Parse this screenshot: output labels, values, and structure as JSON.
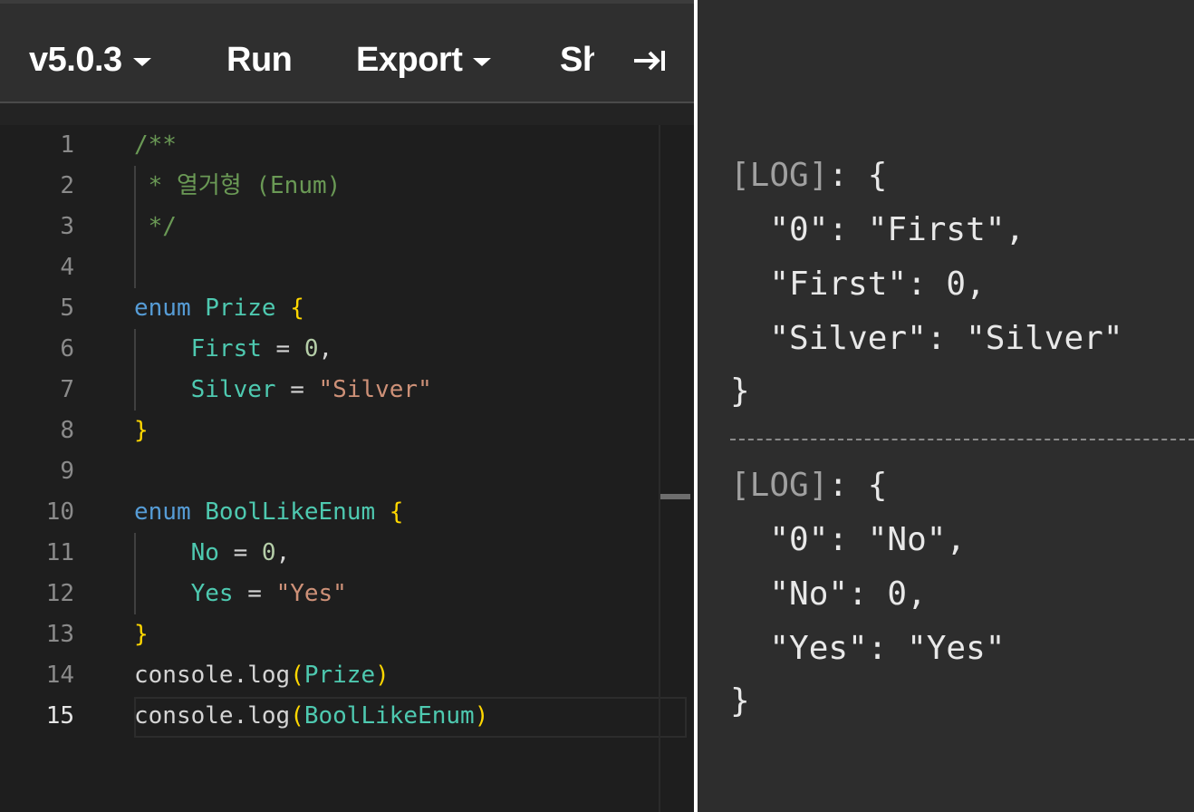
{
  "toolbar": {
    "version_label": "v5.0.3",
    "run_label": "Run",
    "export_label": "Export",
    "share_label": "Share",
    "collapse_icon": "arrow-right-to-bar-icon"
  },
  "editor": {
    "line_numbers": [
      "1",
      "2",
      "3",
      "4",
      "5",
      "6",
      "7",
      "8",
      "9",
      "10",
      "11",
      "12",
      "13",
      "14",
      "15"
    ],
    "active_line": 15,
    "code": {
      "l1": "/**",
      "l2": " * 열거형 (Enum)",
      "l3": " */",
      "l5_kw": "enum",
      "l5_name": "Prize",
      "l6_name": "First",
      "l6_num": "0",
      "l7_name": "Silver",
      "l7_str": "\"Silver\"",
      "l10_kw": "enum",
      "l10_name": "BoolLikeEnum",
      "l11_name": "No",
      "l11_num": "0",
      "l12_name": "Yes",
      "l12_str": "\"Yes\"",
      "l14_obj": "console.log",
      "l14_arg": "Prize",
      "l15_obj": "console.log",
      "l15_arg": "BoolLikeEnum"
    }
  },
  "output": {
    "log_tag": "[LOG]",
    "log1": {
      "line1": "\"0\": \"First\",",
      "line2": "\"First\": 0,",
      "line3": "\"Silver\": \"Silver\""
    },
    "log2": {
      "line1": "\"0\": \"No\",",
      "line2": "\"No\": 0,",
      "line3": "\"Yes\": \"Yes\""
    }
  },
  "colors": {
    "comment": "#6a9955",
    "keyword": "#569cd6",
    "type": "#4ec9b0",
    "brace": "#ffd700",
    "number": "#b5cea8",
    "string": "#ce9178"
  }
}
